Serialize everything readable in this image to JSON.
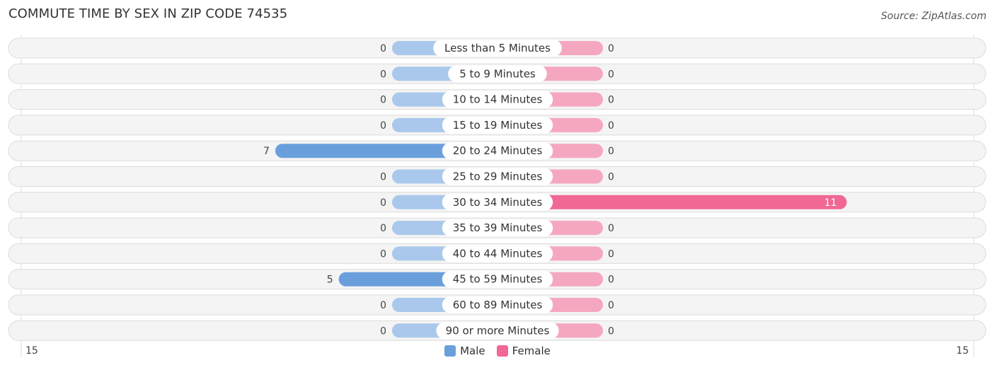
{
  "title": "COMMUTE TIME BY SEX IN ZIP CODE 74535",
  "source": "Source: ZipAtlas.com",
  "chart_data": {
    "type": "bar",
    "orientation": "horizontal-diverging",
    "title": "COMMUTE TIME BY SEX IN ZIP CODE 74535",
    "categories": [
      "Less than 5 Minutes",
      "5 to 9 Minutes",
      "10 to 14 Minutes",
      "15 to 19 Minutes",
      "20 to 24 Minutes",
      "25 to 29 Minutes",
      "30 to 34 Minutes",
      "35 to 39 Minutes",
      "40 to 44 Minutes",
      "45 to 59 Minutes",
      "60 to 89 Minutes",
      "90 or more Minutes"
    ],
    "series": [
      {
        "name": "Male",
        "color": "#6a9fdc",
        "zero_color": "#a9c8eb",
        "values": [
          0,
          0,
          0,
          0,
          7,
          0,
          0,
          0,
          0,
          5,
          0,
          0
        ]
      },
      {
        "name": "Female",
        "color": "#f06893",
        "zero_color": "#f5a7c0",
        "values": [
          0,
          0,
          0,
          0,
          0,
          0,
          11,
          0,
          0,
          0,
          0,
          0
        ]
      }
    ],
    "axis_range": [
      15,
      15
    ],
    "axis_labels": {
      "left": "15",
      "right": "15"
    },
    "legend": [
      "Male",
      "Female"
    ],
    "legend_position": "bottom-center"
  }
}
